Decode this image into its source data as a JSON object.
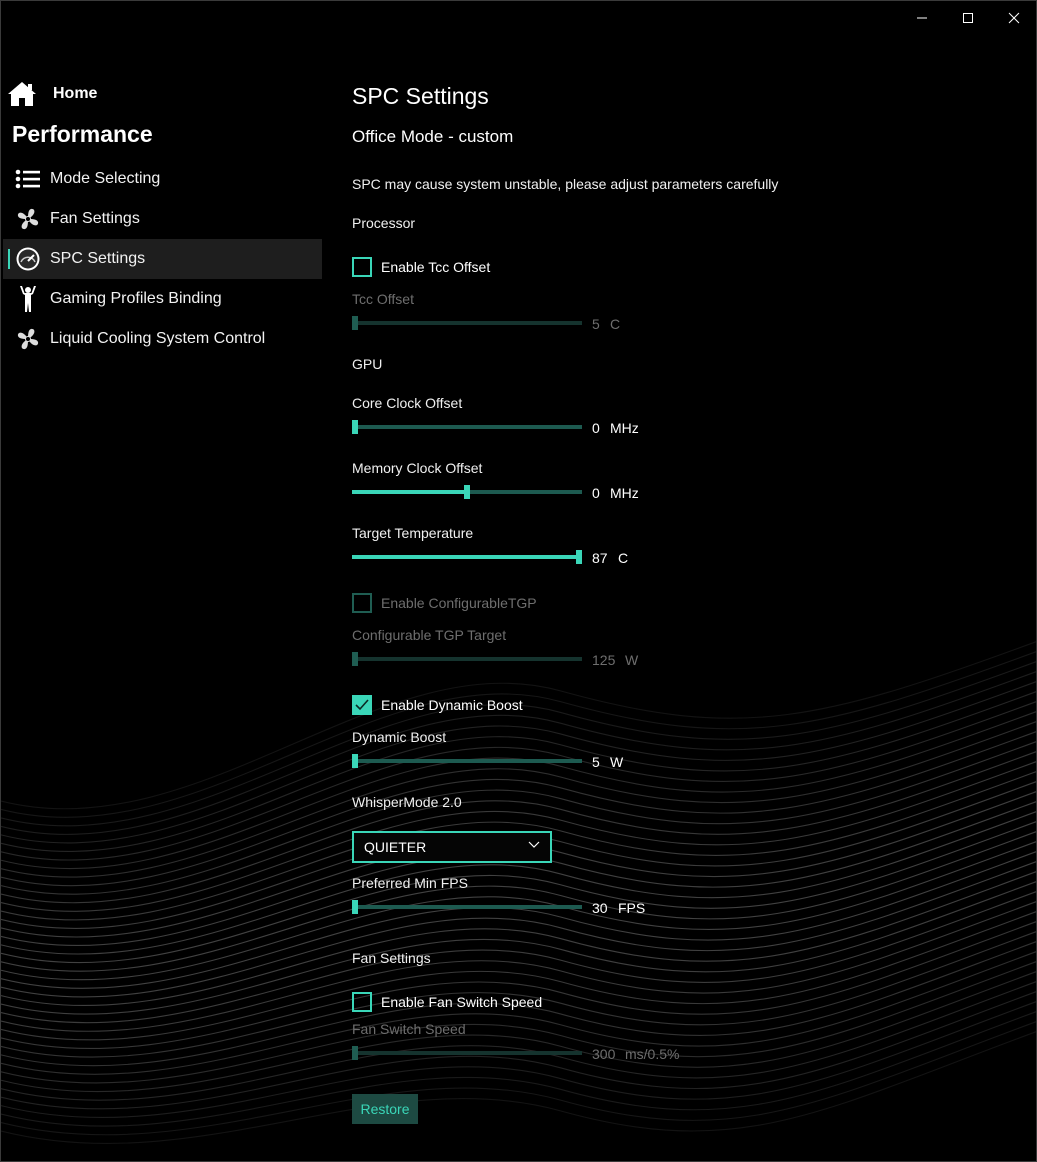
{
  "window": {
    "controls": {
      "minimize": "minimize",
      "maximize": "maximize",
      "close": "close"
    }
  },
  "sidebar": {
    "home_label": "Home",
    "section_title": "Performance",
    "items": [
      {
        "label": "Mode Selecting",
        "icon": "list-icon"
      },
      {
        "label": "Fan Settings",
        "icon": "fan-icon"
      },
      {
        "label": "SPC Settings",
        "icon": "gauge-icon",
        "active": true
      },
      {
        "label": "Gaming Profiles Binding",
        "icon": "person-icon"
      },
      {
        "label": "Liquid Cooling System Control",
        "icon": "fan-icon"
      }
    ]
  },
  "main": {
    "title": "SPC Settings",
    "subtitle": "Office Mode - custom",
    "warning": "SPC may cause system unstable, please adjust parameters carefully",
    "processor_section": "Processor",
    "enable_tcc_offset": {
      "label": "Enable Tcc Offset",
      "checked": false
    },
    "tcc_offset": {
      "label": "Tcc Offset",
      "value": "5",
      "unit": "C",
      "fraction": 0.0,
      "enabled": false
    },
    "gpu_section": "GPU",
    "core_clock_offset": {
      "label": "Core Clock Offset",
      "value": "0",
      "unit": "MHz",
      "fraction": 0.0
    },
    "memory_clock_offset": {
      "label": "Memory Clock Offset",
      "value": "0",
      "unit": "MHz",
      "fraction": 0.5
    },
    "target_temperature": {
      "label": "Target Temperature",
      "value": "87",
      "unit": "C",
      "fraction": 1.0
    },
    "enable_configurable_tgp": {
      "label": "Enable ConfigurableTGP",
      "checked": false,
      "enabled": false
    },
    "configurable_tgp_target": {
      "label": "Configurable TGP Target",
      "value": "125",
      "unit": "W",
      "fraction": 0.0,
      "enabled": false
    },
    "enable_dynamic_boost": {
      "label": "Enable Dynamic Boost",
      "checked": true
    },
    "dynamic_boost": {
      "label": "Dynamic Boost",
      "value": "5",
      "unit": "W",
      "fraction": 0.0
    },
    "whisper_mode_label": "WhisperMode 2.0",
    "whisper_mode_selected": "QUIETER",
    "preferred_min_fps": {
      "label": "Preferred Min FPS",
      "value": "30",
      "unit": "FPS",
      "fraction": 0.0
    },
    "fan_settings_section": "Fan Settings",
    "enable_fan_switch_speed": {
      "label": "Enable Fan Switch Speed",
      "checked": false
    },
    "fan_switch_speed": {
      "label": "Fan Switch Speed",
      "value": "300",
      "unit": "ms/0.5%",
      "fraction": 0.0,
      "enabled": false
    },
    "restore_label": "Restore"
  },
  "colors": {
    "accent": "#3ad6b8",
    "track": "#1d5a50",
    "background": "#000000"
  }
}
